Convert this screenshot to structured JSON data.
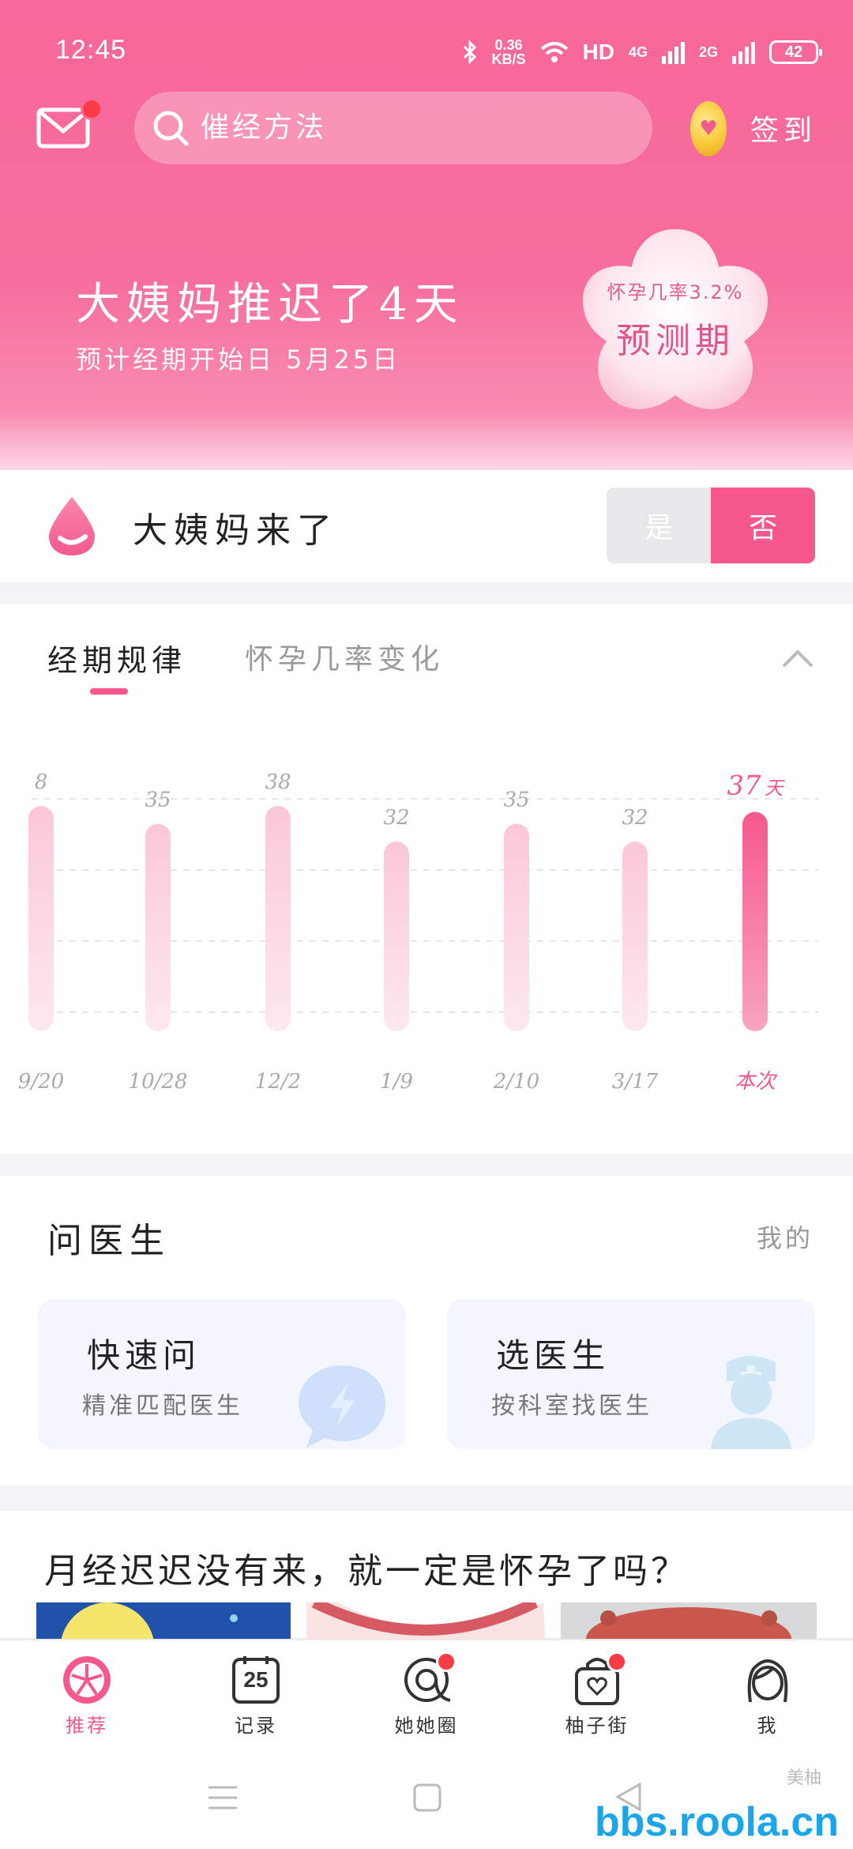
{
  "status_bar": {
    "time": "12:45",
    "speed_value": "0.36",
    "speed_unit": "KB/S",
    "hd": "HD",
    "net1": "4G",
    "net2": "2G",
    "battery": "42"
  },
  "header": {
    "search_placeholder": "催经方法",
    "signin_label": "签到",
    "delay_title": "大姨妈推迟了4天",
    "delay_subtitle": "预计经期开始日 5月25日",
    "badge_small": "怀孕几率3.2%",
    "badge_big": "预测期"
  },
  "period_came": {
    "label": "大姨妈来了",
    "yes": "是",
    "no": "否"
  },
  "chart_tabs": {
    "tab1": "经期规律",
    "tab2": "怀孕几率变化"
  },
  "chart_data": {
    "type": "bar",
    "categories": [
      "9/20",
      "10/28",
      "12/2",
      "1/9",
      "2/10",
      "3/17",
      "本次"
    ],
    "values": [
      38,
      35,
      38,
      32,
      35,
      32,
      37
    ],
    "value_labels": [
      "8",
      "35",
      "38",
      "32",
      "35",
      "32",
      "37"
    ],
    "highlight_unit": "天",
    "highlight_index": 6,
    "ylim": [
      0,
      40
    ],
    "grid": true,
    "colors": {
      "normal": "#fbd3e1",
      "highlight": "#f6588d"
    }
  },
  "doctor": {
    "title": "问医生",
    "mine": "我的",
    "quick_title": "快速问",
    "quick_sub": "精准匹配医生",
    "choose_title": "选医生",
    "choose_sub": "按科室找医生"
  },
  "article": {
    "title": "月经迟迟没有来，就一定是怀孕了吗？"
  },
  "tabbar": [
    {
      "label": "推荐",
      "icon": "grapefruit-icon"
    },
    {
      "label": "记录",
      "icon": "calendar-icon",
      "date": "25"
    },
    {
      "label": "她她圈",
      "icon": "circle-icon"
    },
    {
      "label": "柚子街",
      "icon": "shopping-bag-icon"
    },
    {
      "label": "我",
      "icon": "profile-icon"
    }
  ],
  "watermark": {
    "text": "bbs.roola.cn",
    "small": "美柚"
  },
  "colors": {
    "brand": "#f6588d",
    "header": "#f86b9b"
  }
}
